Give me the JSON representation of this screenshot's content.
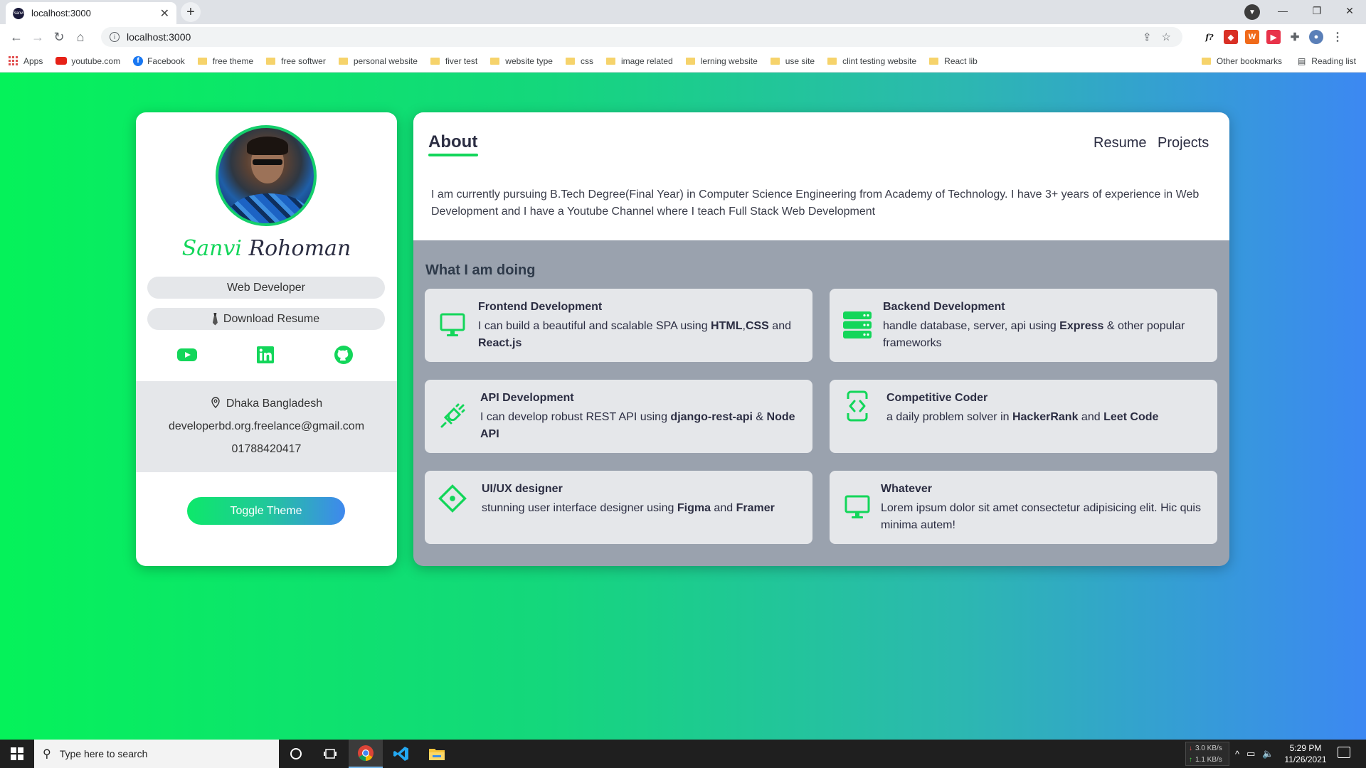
{
  "browser": {
    "tab_title": "localhost:3000",
    "favicon_text": "Sanvi",
    "url": "localhost:3000",
    "bookmarks": [
      "youtube.com",
      "Facebook",
      "free theme",
      "free softwer",
      "personal website",
      "fiver test",
      "website type",
      "css",
      "image related",
      "lerning website",
      "use site",
      "clint testing website",
      "React lib"
    ],
    "apps_label": "Apps",
    "other_bookmarks": "Other bookmarks",
    "reading_list": "Reading list"
  },
  "profile": {
    "first_name": "Sanvi",
    "last_name": "Rohoman",
    "role": "Web Developer",
    "download_label": "Download Resume",
    "location": "Dhaka Bangladesh",
    "email": "developerbd.org.freelance@gmail.com",
    "phone": "01788420417",
    "toggle_label": "Toggle Theme",
    "socials": [
      "youtube-icon",
      "linkedin-icon",
      "github-icon"
    ]
  },
  "main": {
    "about_title": "About",
    "nav": [
      "Resume",
      "Projects"
    ],
    "about_text": "I am currently pursuing B.Tech Degree(Final Year) in Computer Science Engineering from Academy of Technology. I have 3+ years of experience in Web Development and I have a Youtube Channel where I teach Full Stack Web Development",
    "doing_title": "What I am doing",
    "services": [
      {
        "title": "Frontend Development",
        "icon": "monitor-icon",
        "desc": [
          {
            "t": "I can build a beautiful and scalable SPA using "
          },
          {
            "t": "HTML",
            "b": true
          },
          {
            "t": ","
          },
          {
            "t": "CSS",
            "b": true
          },
          {
            "t": " and "
          },
          {
            "t": "React.js",
            "b": true
          }
        ]
      },
      {
        "title": "Backend Development",
        "icon": "server-icon",
        "desc": [
          {
            "t": "handle database, server, api using "
          },
          {
            "t": "Express",
            "b": true
          },
          {
            "t": " & other popular frameworks"
          }
        ]
      },
      {
        "title": "API Development",
        "icon": "plug-icon",
        "desc": [
          {
            "t": "I can develop robust REST API using "
          },
          {
            "t": "django-rest-api",
            "b": true
          },
          {
            "t": " & "
          },
          {
            "t": "Node API",
            "b": true
          }
        ]
      },
      {
        "title": "Competitive Coder",
        "icon": "code-icon",
        "desc": [
          {
            "t": "a daily problem solver in "
          },
          {
            "t": "HackerRank",
            "b": true
          },
          {
            "t": " and "
          },
          {
            "t": "Leet Code",
            "b": true
          }
        ]
      },
      {
        "title": "UI/UX designer",
        "icon": "design-icon",
        "desc": [
          {
            "t": "stunning user interface designer using "
          },
          {
            "t": "Figma",
            "b": true
          },
          {
            "t": " and "
          },
          {
            "t": "Framer",
            "b": true
          }
        ]
      },
      {
        "title": "Whatever",
        "icon": "monitor-icon",
        "desc": [
          {
            "t": "Lorem ipsum dolor sit amet consectetur adipisicing elit. Hic quis minima autem!"
          }
        ]
      }
    ]
  },
  "taskbar": {
    "search_placeholder": "Type here to search",
    "net_down": "3.0 KB/s",
    "net_up": "1.1 KB/s",
    "time": "5:29 PM",
    "date": "11/26/2021"
  },
  "colors": {
    "accent_green": "#13d65a",
    "gradient_start": "#05f25a",
    "gradient_end": "#3c88f2",
    "card_grey": "#9aa2ae"
  }
}
